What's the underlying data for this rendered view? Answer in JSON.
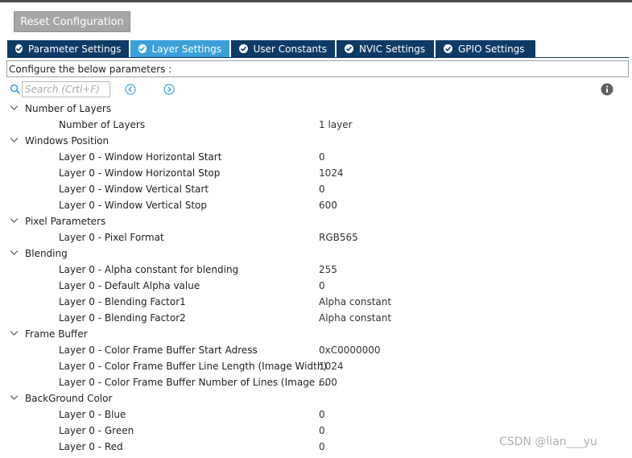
{
  "toolbar": {
    "reset_label": "Reset Configuration"
  },
  "tabs": [
    {
      "label": "Parameter Settings",
      "active": false
    },
    {
      "label": "Layer Settings",
      "active": true
    },
    {
      "label": "User Constants",
      "active": false
    },
    {
      "label": "NVIC Settings",
      "active": false
    },
    {
      "label": "GPIO Settings",
      "active": false
    }
  ],
  "configure_text": "Configure the below parameters :",
  "search": {
    "placeholder": "Search (Crtl+F)"
  },
  "categories": [
    {
      "name": "Number of Layers",
      "params": [
        {
          "label": "Number of Layers",
          "value": "1 layer"
        }
      ]
    },
    {
      "name": "Windows Position",
      "params": [
        {
          "label": "Layer 0 - Window Horizontal Start",
          "value": "0"
        },
        {
          "label": "Layer 0 - Window Horizontal Stop",
          "value": "1024"
        },
        {
          "label": "Layer 0 - Window Vertical Start",
          "value": "0"
        },
        {
          "label": "Layer 0 - Window Vertical Stop",
          "value": "600"
        }
      ]
    },
    {
      "name": "Pixel Parameters",
      "params": [
        {
          "label": "Layer 0 - Pixel Format",
          "value": "RGB565"
        }
      ]
    },
    {
      "name": "Blending",
      "params": [
        {
          "label": "Layer 0 - Alpha constant for blending",
          "value": "255"
        },
        {
          "label": "Layer 0 - Default Alpha value",
          "value": "0"
        },
        {
          "label": "Layer 0 - Blending Factor1",
          "value": "Alpha constant"
        },
        {
          "label": "Layer 0 - Blending Factor2",
          "value": "Alpha constant"
        }
      ]
    },
    {
      "name": "Frame Buffer",
      "params": [
        {
          "label": "Layer 0 - Color Frame Buffer Start Adress",
          "value": "0xC0000000"
        },
        {
          "label": "Layer 0 - Color Frame Buffer Line Length (Image Width)",
          "value": "1024"
        },
        {
          "label": "Layer 0 - Color Frame Buffer Number of Lines (Image ...",
          "value": "600"
        }
      ]
    },
    {
      "name": "BackGround Color",
      "params": [
        {
          "label": "Layer 0 - Blue",
          "value": "0"
        },
        {
          "label": "Layer 0 - Green",
          "value": "0"
        },
        {
          "label": "Layer 0 - Red",
          "value": "0"
        }
      ]
    }
  ],
  "watermark": "CSDN @lian___yu",
  "colors": {
    "tab_dark": "#0d3b66",
    "tab_active": "#3ba0d9",
    "nav_blue": "#3ba0d9"
  }
}
